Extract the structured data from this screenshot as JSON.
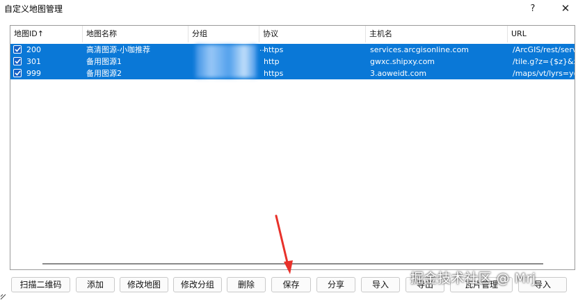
{
  "window": {
    "title": "自定义地图管理",
    "help": "?",
    "close": "✕"
  },
  "table": {
    "headers": [
      "地图ID↑",
      "地图名称",
      "分组",
      "协议",
      "主机名",
      "URL"
    ],
    "rows": [
      {
        "checked": true,
        "id": "200",
        "name": "高清图源-小咖推荐",
        "group": "",
        "protocol": "https",
        "host": "services.arcgisonline.com",
        "url": "/ArcGIS/rest/serv"
      },
      {
        "checked": true,
        "id": "301",
        "name": "备用图源1",
        "group": "",
        "protocol": "http",
        "host": "gwxc.shipxy.com",
        "url": "/tile.g?z={$z}&x="
      },
      {
        "checked": true,
        "id": "999",
        "name": "备用图源2",
        "group": "",
        "protocol": "https",
        "host": "3.aoweidt.com",
        "url": "/maps/vt/lyrs=y@"
      }
    ]
  },
  "group_ellipsis": "...",
  "buttons": {
    "scan_qr": "扫描二维码",
    "add": "添加",
    "edit_map": "修改地图",
    "edit_group": "修改分组",
    "delete": "删除",
    "save": "保存",
    "share": "分享",
    "import": "导入",
    "export_partial": "导出",
    "tile_manage": "瓦片管理",
    "exit_partial": "导入"
  },
  "watermark": "掘金技术社区 @ Mrj",
  "colors": {
    "selection": "#0a78d7",
    "arrow": "#e8312a"
  }
}
